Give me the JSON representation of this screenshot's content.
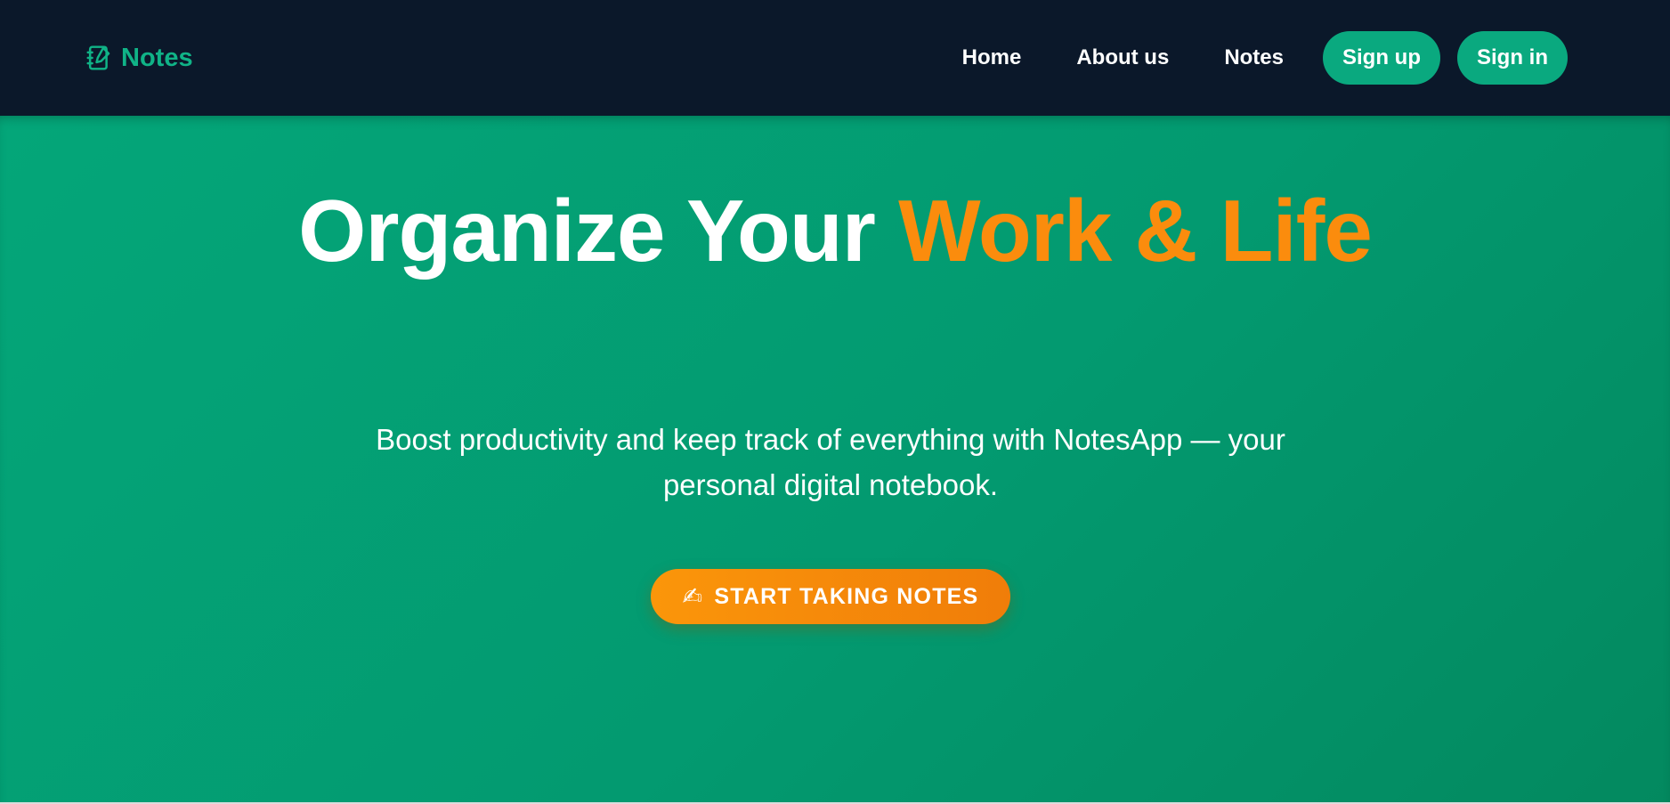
{
  "colors": {
    "navbar_bg": "#0b182a",
    "brand": "#10b387",
    "pill_bg": "#0aa97f",
    "hero_gradient": [
      "#04a679",
      "#03895f"
    ],
    "accent": "#fb8c0d",
    "cta_gradient": [
      "#fb960a",
      "#f07d09"
    ]
  },
  "navbar": {
    "brand": {
      "icon": "notebook-edit-icon",
      "label": "Notes"
    },
    "links": [
      {
        "label": "Home"
      },
      {
        "label": "About us"
      },
      {
        "label": "Notes"
      }
    ],
    "signup_label": "Sign up",
    "signin_label": "Sign in"
  },
  "hero": {
    "title_part1": "Organize Your ",
    "title_accent": "Work & Life",
    "subtitle_part1": "Boost productivity and keep track of everything with ",
    "subtitle_strong": "NotesApp",
    "subtitle_part2": " — your personal digital notebook.",
    "cta": {
      "icon": "writing-hand-icon",
      "icon_glyph": "✍",
      "label": "START TAKING NOTES"
    }
  }
}
